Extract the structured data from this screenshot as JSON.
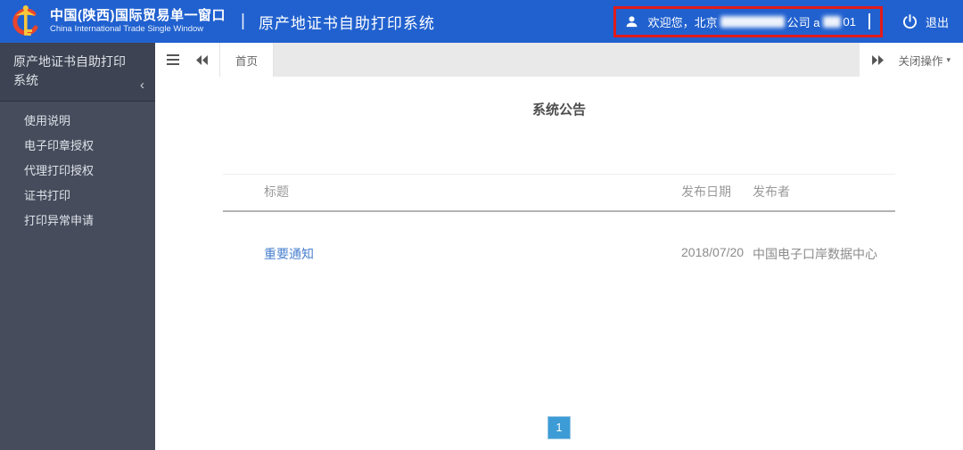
{
  "header": {
    "brand_title": "中国(陕西)国际贸易单一窗口",
    "brand_subtitle": "China International Trade Single Window",
    "title_divider": "|",
    "app_title": "原产地证书自助打印系统",
    "welcome_prefix": "欢迎您，北京",
    "welcome_mid": "公司 a",
    "welcome_suffix": "01",
    "logout_label": "退出"
  },
  "sidebar": {
    "title": "原产地证书自助打印系统",
    "collapse_icon": "‹",
    "items": [
      {
        "label": "使用说明"
      },
      {
        "label": "电子印章授权"
      },
      {
        "label": "代理打印授权"
      },
      {
        "label": "证书打印"
      },
      {
        "label": "打印异常申请"
      }
    ]
  },
  "tabbar": {
    "active_tab": "首页",
    "close_menu_label": "关闭操作",
    "caret": "▾"
  },
  "main": {
    "title": "系统公告",
    "table": {
      "columns": {
        "title": "标题",
        "date": "发布日期",
        "publisher": "发布者"
      },
      "rows": [
        {
          "title": "重要通知",
          "date": "2018/07/20",
          "publisher": "中国电子口岸数据中心"
        }
      ]
    },
    "pagination": {
      "current_page": "1"
    }
  },
  "colors": {
    "header_bg": "#2161cf",
    "annotation_red": "#e11b1b",
    "sidebar_head_bg": "#3d4352",
    "sidebar_menu_bg": "#464c5c",
    "tab_strip_gray": "#e9e9e9",
    "link_blue": "#4a80d0",
    "pagination_blue": "#3d9cd6"
  }
}
